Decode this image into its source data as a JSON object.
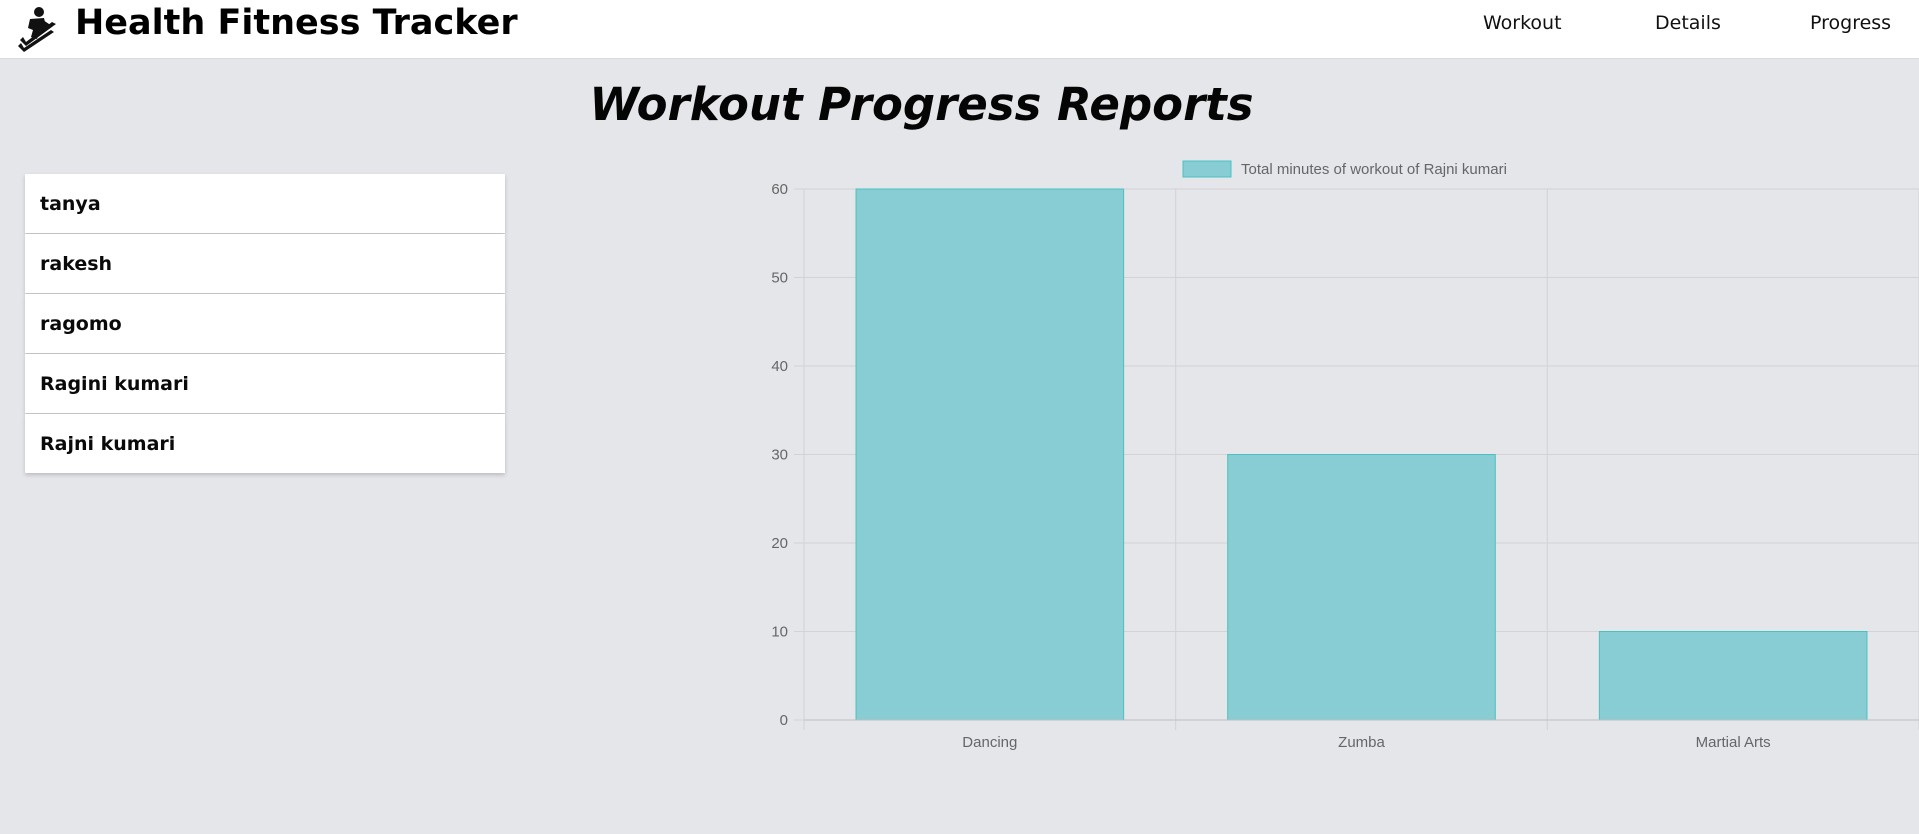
{
  "app": {
    "title": "Health Fitness Tracker",
    "logo_icon": "fitness-runner-logo"
  },
  "nav": {
    "items": [
      {
        "label": "Workout"
      },
      {
        "label": "Details"
      },
      {
        "label": "Progress"
      }
    ]
  },
  "page": {
    "title": "Workout Progress Reports"
  },
  "users": [
    {
      "name": "tanya"
    },
    {
      "name": "rakesh"
    },
    {
      "name": "ragomo"
    },
    {
      "name": "Ragini kumari"
    },
    {
      "name": "Rajni kumari"
    }
  ],
  "colors": {
    "bar_fill": "#88cdd3",
    "bar_stroke": "#4bc0c0",
    "grid": "#d3d3d6",
    "background": "#e5e6ea"
  },
  "chart_data": {
    "type": "bar",
    "categories": [
      "Dancing",
      "Zumba",
      "Martial Arts"
    ],
    "series": [
      {
        "name": "Total minutes of workout of Rajni kumari",
        "values": [
          60,
          30,
          10
        ]
      }
    ],
    "ylim": [
      0,
      60
    ],
    "yticks": [
      0,
      10,
      20,
      30,
      40,
      50,
      60
    ],
    "grid": true,
    "legend": "top-center"
  }
}
